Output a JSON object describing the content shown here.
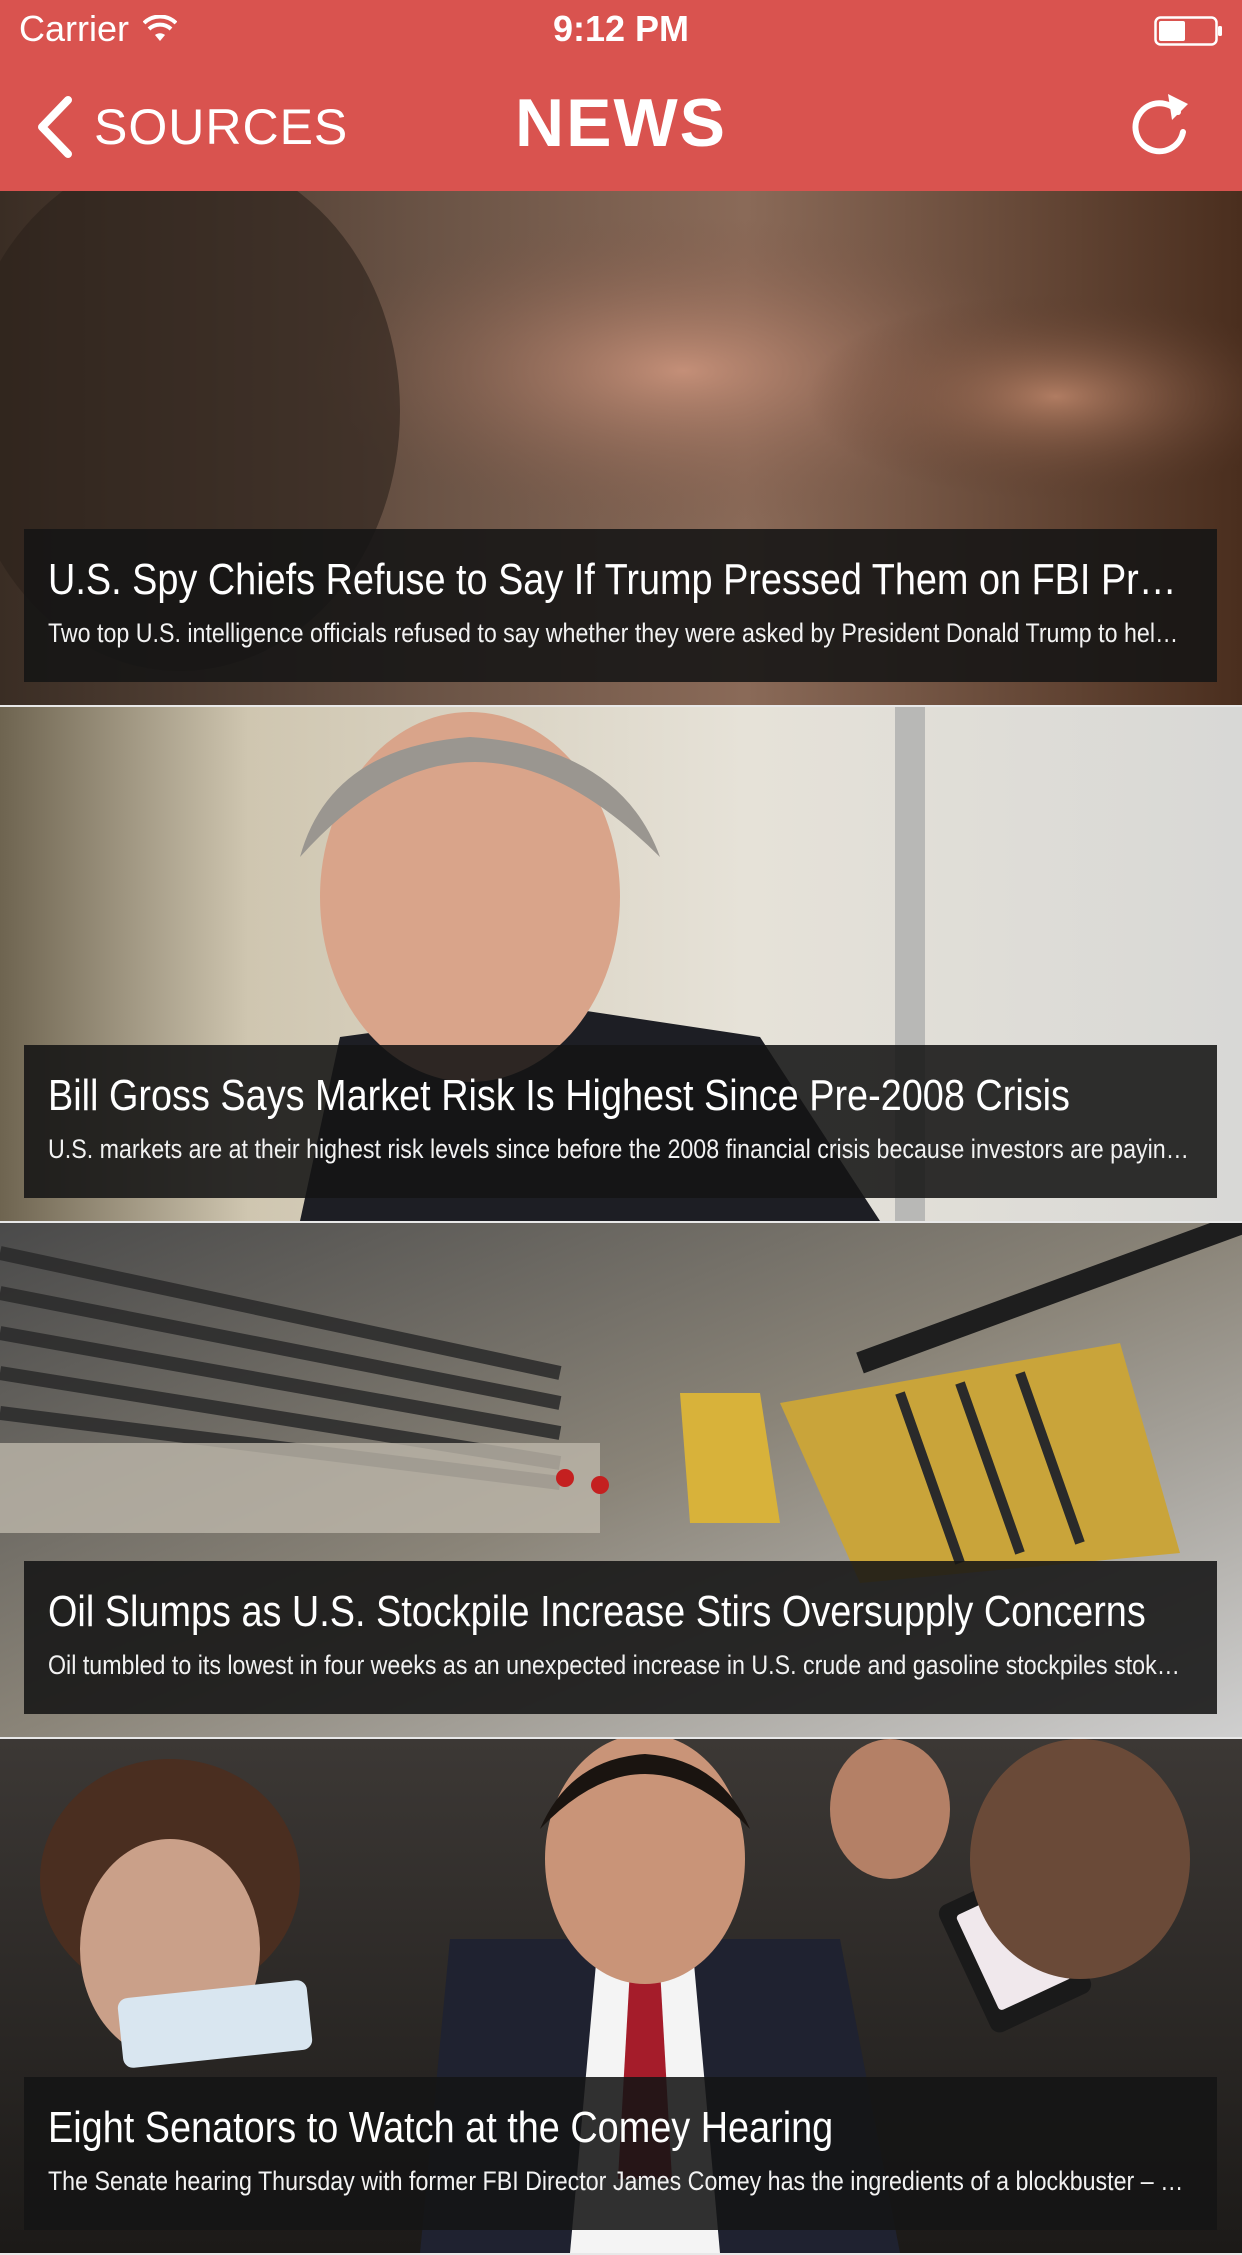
{
  "status_bar": {
    "carrier": "Carrier",
    "time": "9:12 PM"
  },
  "nav": {
    "back_label": "SOURCES",
    "title": "NEWS",
    "icons": {
      "back": "chevron-left-icon",
      "refresh": "refresh-icon"
    }
  },
  "colors": {
    "accent": "#d9534f",
    "caption_bg": "#141414"
  },
  "articles": [
    {
      "headline": "U.S. Spy Chiefs Refuse to Say If Trump Pressed Them on FBI Probe",
      "summary": "Two top U.S. intelligence officials refused to say whether they were asked by President Donald Trump to help impede a..."
    },
    {
      "headline": "Bill Gross Says Market Risk Is Highest Since Pre-2008 Crisis",
      "summary": "U.S. markets are at their highest risk levels since before the 2008 financial crisis because investors are paying a high p..."
    },
    {
      "headline": "Oil Slumps as U.S. Stockpile Increase Stirs Oversupply Concerns",
      "summary": "Oil tumbled to its lowest in four weeks as an unexpected increase in U.S. crude and gasoline stockpiles stoked fears tha..."
    },
    {
      "headline": "Eight Senators to Watch at the Comey Hearing",
      "summary": "The Senate hearing Thursday with former FBI Director James Comey has the ingredients of a blockbuster – drama, mys..."
    }
  ]
}
